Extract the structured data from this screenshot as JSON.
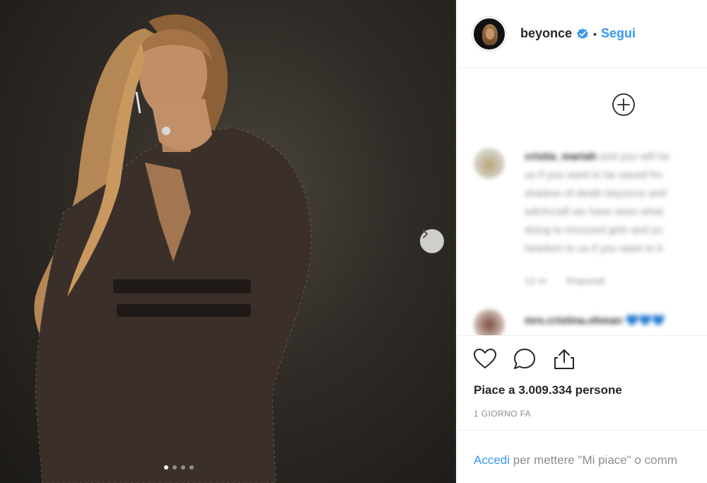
{
  "post": {
    "username": "beyonce",
    "separator": "•",
    "follow_label": "Segui",
    "likes_text": "Piace a 3.009.334 persone",
    "timestamp": "1 GIORNO FA",
    "login_link": "Accedi",
    "login_rest": " per mettere \"Mi piace\" o comm"
  },
  "comments": [
    {
      "user": "cristia_mariah",
      "lines": [
        "and you will he",
        "us if you want to be saved fro",
        "shadow of death beyonce and",
        "witchcraft we have seen what",
        "doing to innocent girls and yo",
        "hearken to us if you want to b"
      ],
      "age": "12 m",
      "reply": "Rispondi"
    },
    {
      "user": "mrs.cristina.ohman",
      "lines": [
        "💙💙💙"
      ]
    }
  ],
  "carousel": {
    "total": 4,
    "current": 1
  },
  "colors": {
    "accent": "#3897f0",
    "text": "#262626",
    "muted": "#8e8e8e"
  },
  "icons": [
    "verified-badge-icon",
    "plus-circle-icon",
    "chevron-right-icon",
    "heart-icon",
    "comment-icon",
    "share-icon"
  ]
}
